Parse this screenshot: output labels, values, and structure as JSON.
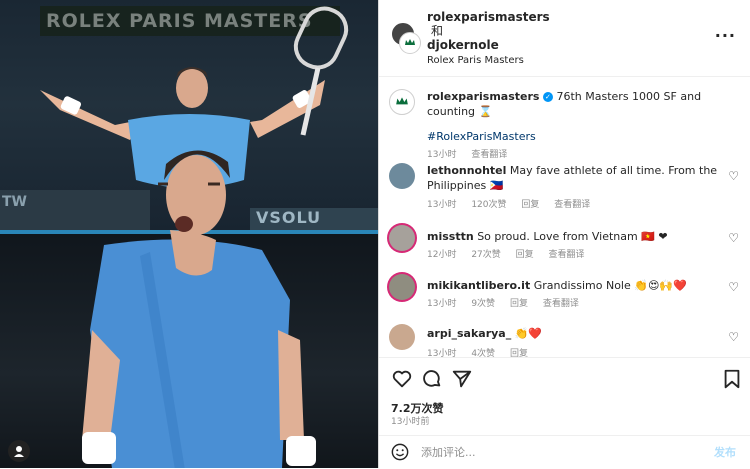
{
  "photo": {
    "banner_text": "ROLEX PARIS MASTERS",
    "stand_left_text": "TW",
    "stand_right_text": "VSOLU"
  },
  "header": {
    "account1": "rolexparismasters",
    "joiner": "和",
    "account2": "djokernole",
    "location": "Rolex Paris Masters",
    "more_icon": "more-horizontal-icon"
  },
  "caption": {
    "username": "rolexparismasters",
    "text": "76th Masters 1000 SF and counting ⌛",
    "hashtag": "#RolexParisMasters",
    "time": "13小时",
    "translate": "查看翻译"
  },
  "comments": [
    {
      "username": "lethonnohtel",
      "text": "May fave athlete of all time. From the Philippines 🇵🇭",
      "time": "13小时",
      "likes": "120次赞",
      "reply": "回复",
      "translate": "查看翻译"
    },
    {
      "username": "missttn",
      "text": "So proud. Love from Vietnam 🇻🇳 ❤",
      "time": "12小时",
      "likes": "27次赞",
      "reply": "回复",
      "translate": "查看翻译"
    },
    {
      "username": "mikikantlibero.it",
      "text": "Grandissimo Nole 👏😍🙌❤️",
      "time": "13小时",
      "likes": "9次赞",
      "reply": "回复",
      "translate": "查看翻译"
    },
    {
      "username": "arpi_sakarya_",
      "text": "👏❤️",
      "time": "13小时",
      "likes": "4次赞",
      "reply": "回复"
    }
  ],
  "actions": {
    "like_count": "7.2万次赞",
    "post_time": "13小时前"
  },
  "composer": {
    "placeholder": "添加评论...",
    "send_label": "发布"
  }
}
